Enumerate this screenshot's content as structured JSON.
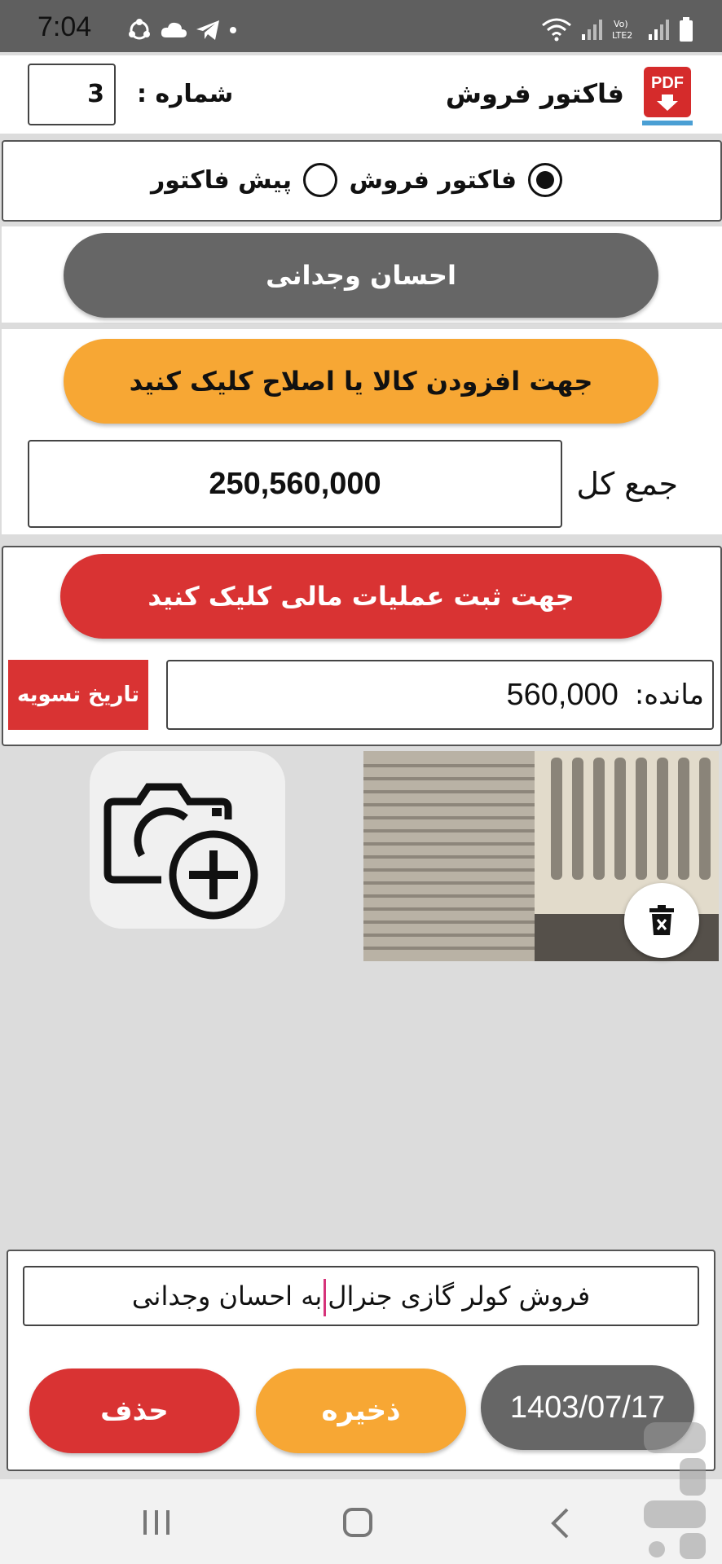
{
  "status_bar": {
    "time": "7:04",
    "network_label": "Vo)\nLTE2"
  },
  "header": {
    "title": "فاکتور فروش",
    "number_label": "شماره :",
    "number_value": "3",
    "pdf_icon_text": "PDF"
  },
  "invoice_type": {
    "options": [
      {
        "label": "فاکتور فروش",
        "selected": true
      },
      {
        "label": "پیش فاکتور",
        "selected": false
      }
    ]
  },
  "customer": {
    "name": "احسان وجدانی"
  },
  "items": {
    "add_button_label": "جهت افزودن کالا یا اصلاح کلیک کنید",
    "total_label": "جمع کل",
    "total_value": "250,560,000"
  },
  "finance": {
    "button_label": "جهت ثبت عملیات مالی کلیک کنید",
    "remaining_label": "مانده:",
    "remaining_value": "560,000",
    "settle_date_label": "تاریخ تسویه"
  },
  "attachments": {
    "add_photo_icon": "camera-add-icon",
    "delete_icon": "trash-icon"
  },
  "footer": {
    "description_before_caret": "فروش کولر گازی جنرال",
    "description_after_caret": "به احسان وجدانی",
    "delete_label": "حذف",
    "save_label": "ذخیره",
    "date_label": "1403/07/17"
  },
  "colors": {
    "red": "#d93333",
    "orange": "#f7a734",
    "gray": "#666666",
    "background": "#dcdcdc"
  }
}
